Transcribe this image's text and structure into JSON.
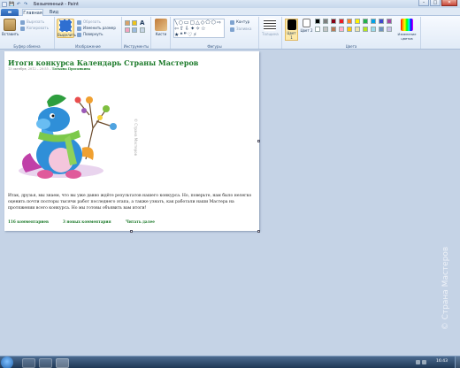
{
  "window": {
    "title": "Безымянный - Paint",
    "controls": {
      "minimize": "–",
      "maximize": "□",
      "close": "✕"
    }
  },
  "quick_access": {
    "save_icon": "💾",
    "undo_icon": "↶",
    "redo_icon": "↷"
  },
  "tabs": {
    "file": "▬",
    "home": "Главная",
    "view": "Вид"
  },
  "ribbon": {
    "clipboard": {
      "label": "Буфер обмена",
      "paste": "Вставить",
      "cut": "Вырезать",
      "copy": "Копировать"
    },
    "image": {
      "label": "Изображение",
      "select": "Выделить",
      "crop": "Обрезать",
      "resize": "Изменить размер",
      "rotate": "Повернуть"
    },
    "tools": {
      "label": "Инструменты",
      "text_icon": "A"
    },
    "brushes": {
      "label": "Кисти"
    },
    "shapes": {
      "label": "Фигуры",
      "outline": "Контур",
      "fill": "Заливка",
      "glyphs": "╲○▭▢△◇⬠⬡⇨⇦⇧⇩✦✧☆★❝❞♡⚡"
    },
    "size": {
      "label": "Толщина"
    },
    "colors": {
      "label": "Цвета",
      "color1": "Цвет 1",
      "color2": "Цвет 2",
      "edit": "Изменение цветов",
      "palette_row1": [
        "#000000",
        "#7f7f7f",
        "#880015",
        "#ed1c24",
        "#ff7f27",
        "#fff200",
        "#22b14c",
        "#00a2e8",
        "#3f48cc",
        "#a349a4"
      ],
      "palette_row2": [
        "#ffffff",
        "#c3c3c3",
        "#b97a57",
        "#ffaec9",
        "#ffc90e",
        "#efe4b0",
        "#b5e61d",
        "#99d9ea",
        "#7092be",
        "#c8bfe7"
      ]
    }
  },
  "post": {
    "title": "Итоги конкурса Календарь Страны Мастеров",
    "date": "13 октября, 2012 – 20:55 –",
    "author": "Татьяна Просянкина",
    "image_watermark": "© Страна Мастеров",
    "body": "Итак, друзья, мы знаем, что вы уже давно ждёте результатов нашего конкурса. Но, поверьте, нам было нелегко оценить почти полторы тысячи работ последнего этапа, а также узнать, как работали наши Мастера на протяжении всего конкурса. Но мы готовы объявить вам итоги!",
    "links": {
      "comments": "116 комментариев",
      "new_comments": "3 новых комментария",
      "read_more": "Читать далее"
    }
  },
  "side_watermark": "© Страна Мастеров",
  "taskbar": {
    "clock": "16:43"
  }
}
